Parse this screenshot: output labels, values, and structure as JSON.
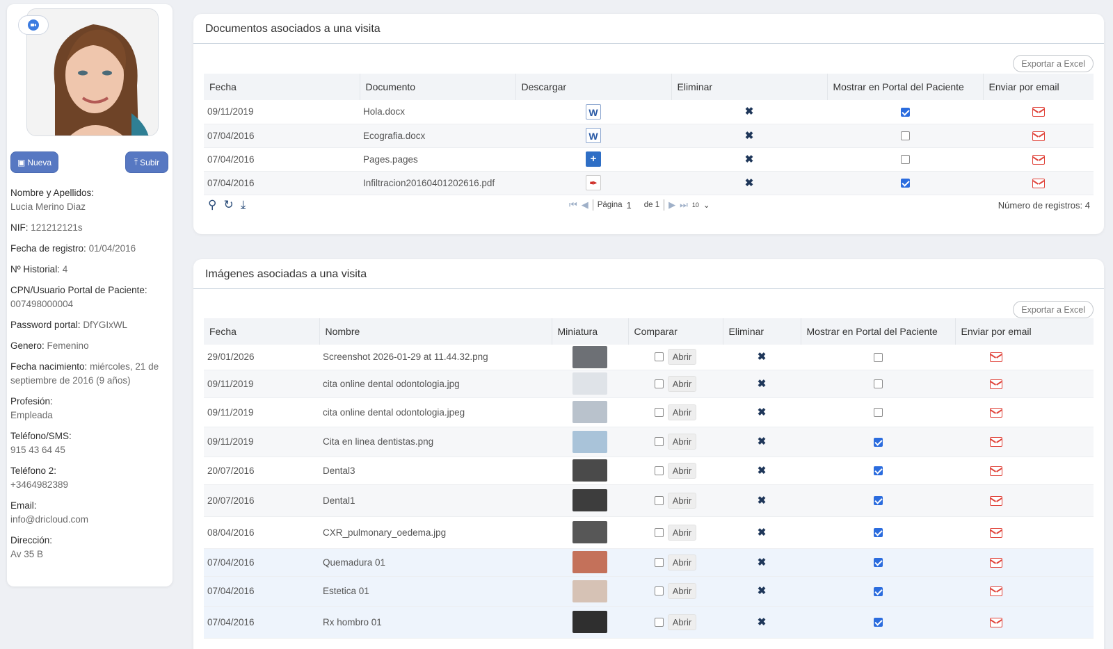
{
  "sidebar": {
    "buttons": {
      "nueva": "Nueva",
      "subir": "Subir"
    },
    "fields": [
      {
        "label": "Nombre y Apellidos:",
        "value": "Lucia Merino Diaz",
        "block": true
      },
      {
        "label": "NIF:",
        "value": "121212121s",
        "block": false
      },
      {
        "label": "Fecha de registro:",
        "value": "01/04/2016",
        "block": false
      },
      {
        "label": "Nº Historial:",
        "value": "4",
        "block": false
      },
      {
        "label": "CPN/Usuario Portal de Paciente:",
        "value": "007498000004",
        "block": true
      },
      {
        "label": "Password portal:",
        "value": "DfYGIxWL",
        "block": false
      },
      {
        "label": "Genero:",
        "value": "Femenino",
        "block": false
      },
      {
        "label": "Fecha nacimiento:",
        "value": "miércoles, 21 de septiembre de 2016 (9 años)",
        "block": false
      },
      {
        "label": "Profesión:",
        "value": "Empleada",
        "block": true
      },
      {
        "label": "Teléfono/SMS:",
        "value": "915 43 64 45",
        "block": true
      },
      {
        "label": "Teléfono 2:",
        "value": "+3464982389",
        "block": true
      },
      {
        "label": "Email:",
        "value": "info@dricloud.com",
        "block": true
      },
      {
        "label": "Dirección:",
        "value": "Av 35 B",
        "block": true
      }
    ]
  },
  "documents": {
    "title": "Documentos asociados a una visita",
    "export_label": "Exportar a Excel",
    "columns": [
      "Fecha",
      "Documento",
      "Descargar",
      "Eliminar",
      "Mostrar en Portal del Paciente",
      "Enviar por email"
    ],
    "rows": [
      {
        "fecha": "09/11/2019",
        "documento": "Hola.docx",
        "icon": "word-icon",
        "portal": true
      },
      {
        "fecha": "07/04/2016",
        "documento": "Ecografia.docx",
        "icon": "word-icon",
        "portal": false
      },
      {
        "fecha": "07/04/2016",
        "documento": "Pages.pages",
        "icon": "pages-icon",
        "portal": false
      },
      {
        "fecha": "07/04/2016",
        "documento": "Infiltracion20160401202616.pdf",
        "icon": "pdf-icon",
        "portal": true
      }
    ],
    "pager": {
      "page_label": "Página",
      "page": "1",
      "of_label": "de 1",
      "page_size": "10",
      "count_label": "Número de registros: 4"
    }
  },
  "images": {
    "title": "Imágenes asociadas a una visita",
    "export_label": "Exportar a Excel",
    "open_label": "Abrir",
    "columns": [
      "Fecha",
      "Nombre",
      "Miniatura",
      "Comparar",
      "Eliminar",
      "Mostrar en Portal del Paciente",
      "Enviar por email"
    ],
    "rows": [
      {
        "fecha": "29/01/2026",
        "nombre": "Screenshot 2026-01-29 at 11.44.32.png",
        "portal": false,
        "thumb": "#6d7075"
      },
      {
        "fecha": "09/11/2019",
        "nombre": "cita online dental odontologia.jpg",
        "portal": false,
        "thumb": "#dfe3e8"
      },
      {
        "fecha": "09/11/2019",
        "nombre": "cita online dental odontologia.jpeg",
        "portal": false,
        "thumb": "#b9c2cc"
      },
      {
        "fecha": "09/11/2019",
        "nombre": "Cita en linea dentistas.png",
        "portal": true,
        "thumb": "#a9c3d9"
      },
      {
        "fecha": "20/07/2016",
        "nombre": "Dental3",
        "portal": true,
        "thumb": "#4a4a4a"
      },
      {
        "fecha": "20/07/2016",
        "nombre": "Dental1",
        "portal": true,
        "thumb": "#3d3d3d"
      },
      {
        "fecha": "08/04/2016",
        "nombre": "CXR_pulmonary_oedema.jpg",
        "portal": true,
        "thumb": "#575757"
      },
      {
        "fecha": "07/04/2016",
        "nombre": "Quemadura 01",
        "portal": true,
        "thumb": "#c4715a"
      },
      {
        "fecha": "07/04/2016",
        "nombre": "Estetica 01",
        "portal": true,
        "thumb": "#d6c2b5"
      },
      {
        "fecha": "07/04/2016",
        "nombre": "Rx hombro 01",
        "portal": true,
        "thumb": "#2f2f2f"
      }
    ]
  }
}
